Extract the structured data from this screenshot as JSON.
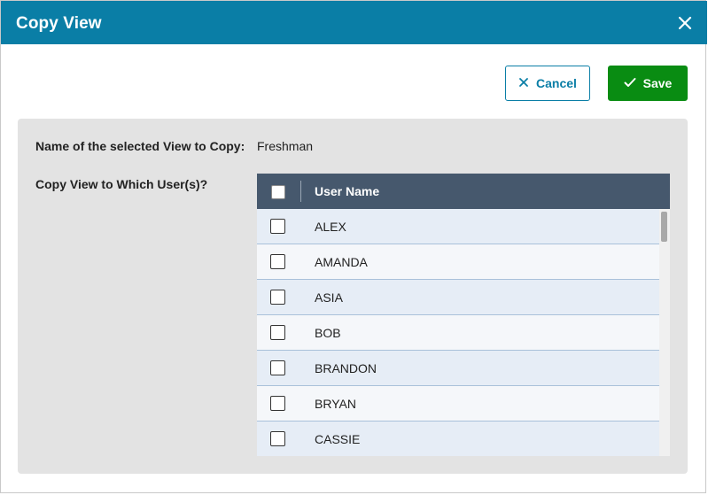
{
  "dialog": {
    "title": "Copy View",
    "close_icon": "close-icon",
    "header_color": "#0a7ea6"
  },
  "actions": {
    "cancel_label": "Cancel",
    "cancel_icon": "x-icon",
    "save_label": "Save",
    "save_icon": "checkmark-icon",
    "save_color": "#098c12"
  },
  "form": {
    "selected_view_label": "Name of the selected View to Copy:",
    "selected_view_value": "Freshman",
    "copy_to_label": "Copy View to Which User(s)?"
  },
  "users_grid": {
    "column_header": "User Name",
    "header_color": "#46586d",
    "rows": [
      {
        "name": "ALEX",
        "checked": false
      },
      {
        "name": "AMANDA",
        "checked": false
      },
      {
        "name": "ASIA",
        "checked": false
      },
      {
        "name": "BOB",
        "checked": false
      },
      {
        "name": "BRANDON",
        "checked": false
      },
      {
        "name": "BRYAN",
        "checked": false
      },
      {
        "name": "CASSIE",
        "checked": false
      }
    ]
  }
}
